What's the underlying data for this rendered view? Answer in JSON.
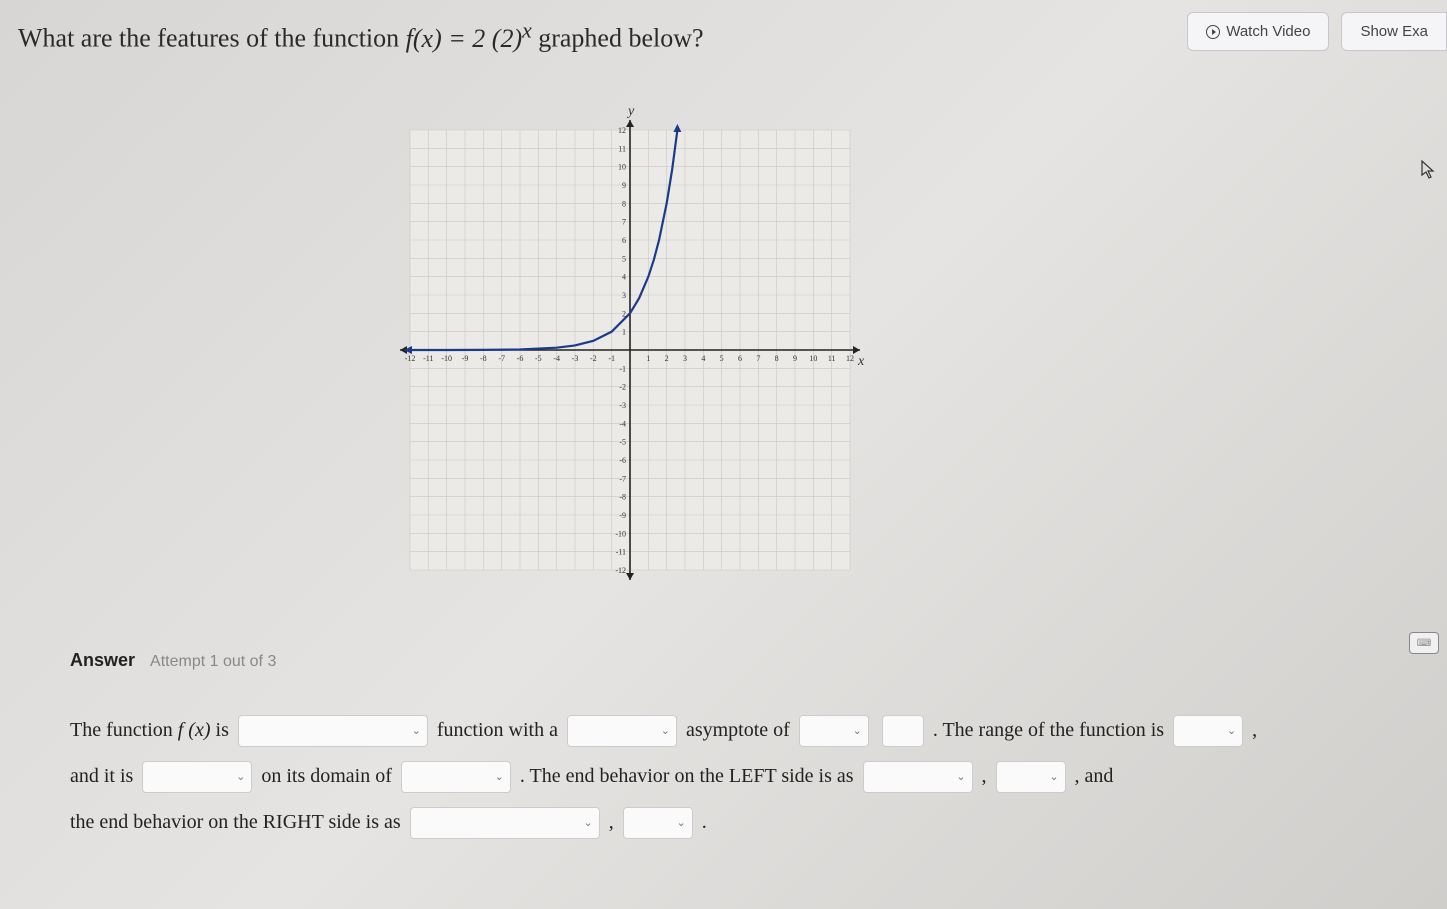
{
  "header": {
    "watch_video": "Watch Video",
    "show_examples": "Show Exa"
  },
  "question": {
    "prefix": "What are the features of the function ",
    "func_lhs": "f(x) = 2 (2)",
    "exp": "x",
    "suffix": " graphed below?"
  },
  "chart_data": {
    "type": "line",
    "title": "",
    "xlabel": "x",
    "ylabel": "y",
    "xlim": [
      -12,
      12
    ],
    "ylim": [
      -12,
      12
    ],
    "x_ticks": [
      -12,
      -11,
      -10,
      -9,
      -8,
      -7,
      -6,
      -5,
      -4,
      -3,
      -2,
      -1,
      1,
      2,
      3,
      4,
      5,
      6,
      7,
      8,
      9,
      10,
      11,
      12
    ],
    "y_ticks": [
      -12,
      -11,
      -10,
      -9,
      -8,
      -7,
      -6,
      -5,
      -4,
      -3,
      -2,
      -1,
      1,
      2,
      3,
      4,
      5,
      6,
      7,
      8,
      9,
      10,
      11,
      12
    ],
    "series": [
      {
        "name": "f(x)=2(2)^x",
        "x": [
          -12,
          -10,
          -8,
          -6,
          -4,
          -3,
          -2,
          -1,
          0,
          0.5,
          1,
          1.3,
          1.585,
          2,
          2.3,
          2.585
        ],
        "y": [
          0.00049,
          0.00195,
          0.00781,
          0.03125,
          0.125,
          0.25,
          0.5,
          1,
          2,
          2.83,
          4,
          4.92,
          6,
          8,
          9.85,
          12
        ]
      }
    ],
    "asymptote": {
      "axis": "y",
      "value": 0
    }
  },
  "answer": {
    "heading": "Answer",
    "attempt": "Attempt 1 out of 3",
    "line1_a": "The function ",
    "line1_fx": "f (x)",
    "line1_b": " is",
    "line1_c": "function with a",
    "line1_d": "asymptote of",
    "line1_e": ". The range of the function is",
    "line2_a": "and it is",
    "line2_b": "on its domain of",
    "line2_c": ". The end behavior on the LEFT side is as",
    "line2_d": ", and",
    "line3_a": "the end behavior on the RIGHT side is as",
    "comma": ",",
    "period": "."
  }
}
